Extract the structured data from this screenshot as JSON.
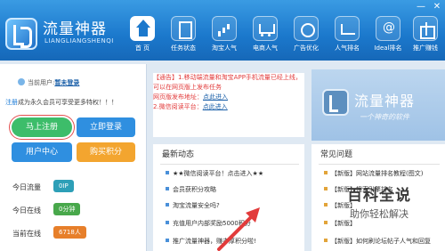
{
  "header": {
    "app_title": "流量神器",
    "app_subtitle": "LIANGLIANGSHENQI",
    "minimize": "—",
    "close": "✕",
    "nav": [
      {
        "label": "首 页",
        "icon": "home-icon"
      },
      {
        "label": "任务状态",
        "icon": "task-icon"
      },
      {
        "label": "淘宝人气",
        "icon": "chart-icon"
      },
      {
        "label": "电商人气",
        "icon": "cart-icon"
      },
      {
        "label": "广告优化",
        "icon": "tools-icon"
      },
      {
        "label": "人气排名",
        "icon": "trend-icon"
      },
      {
        "label": "Ideal排名",
        "icon": "at-icon"
      },
      {
        "label": "推广赚钱",
        "icon": "gift-icon"
      }
    ]
  },
  "left": {
    "user_label": "当前用户:",
    "user_name": "暂未登录",
    "reg_note_prefix": "注册",
    "reg_note_rest": "成为永久会员可享受更多特权！！！",
    "buttons": {
      "register": "马上注册",
      "login": "立即登录",
      "user_center": "用户中心",
      "buy_points": "购买积分"
    },
    "stats": [
      {
        "label": "今日流量",
        "value": "0IP"
      },
      {
        "label": "今日在线",
        "value": "0分钟"
      },
      {
        "label": "当前在线",
        "value": "6718人"
      }
    ]
  },
  "notice": {
    "tag": "【通告】",
    "line1": "1.移动端流量和淘宝APP手机流量已经上线，可以在网页版上发布任务",
    "line2_prefix": "网页版发布地址：",
    "line2_link": "点此进入",
    "line3_prefix": "2.微信阅读平台：",
    "line3_link": "点此进入"
  },
  "banner": {
    "title": "流量神器",
    "slogan": "一个神奇的软件"
  },
  "news": {
    "title": "最新动态",
    "items": [
      "★★微信阅读平台！点击进入★★",
      "会员获积分攻略",
      "淘宝流量安全吗?",
      "充值用户内部奖励5000积分",
      "推广流量神器，赚丰厚积分啦!"
    ]
  },
  "faq": {
    "title": "常见问题",
    "items": [
      "【新版】网站流量排名教程(图文)",
      "【新版】搜索引擎排名",
      "【新版】",
      "【新版】",
      "【新版】如何刷论坛帖子人气和回复"
    ]
  },
  "watermark": {
    "main": "百科全说",
    "sub": "助你轻松解决"
  },
  "colors": {
    "header": "#1b78cc",
    "register_button": "#3dbd6a",
    "login_button": "#2f8fe0",
    "buy_button": "#f3a52f",
    "annotation": "#e23b3b"
  }
}
